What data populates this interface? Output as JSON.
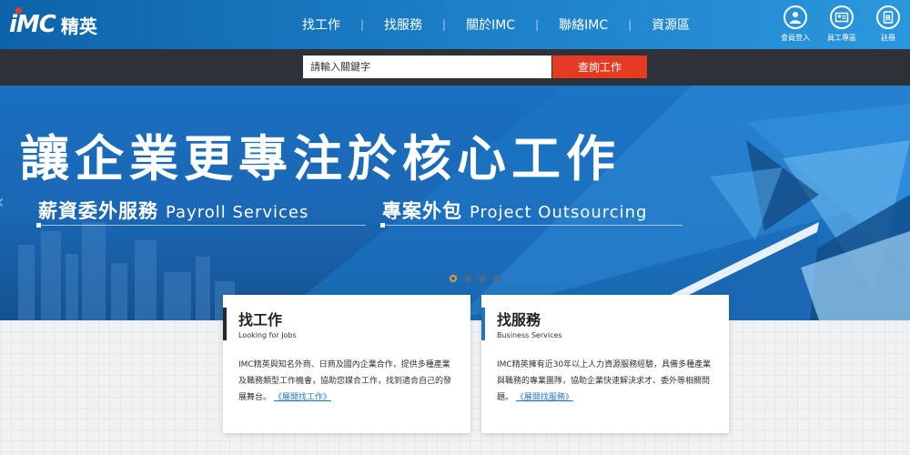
{
  "header": {
    "logo_text": "iMC",
    "logo_cn": "精英",
    "nav": [
      {
        "label": "找工作"
      },
      {
        "label": "找服務"
      },
      {
        "label": "關於IMC"
      },
      {
        "label": "聯絡IMC"
      },
      {
        "label": "資源區"
      }
    ],
    "user_icons": [
      {
        "label": "會員登入",
        "icon": "user-icon"
      },
      {
        "label": "員工專區",
        "icon": "id-card-icon"
      },
      {
        "label": "註冊",
        "icon": "register-icon"
      }
    ]
  },
  "search": {
    "placeholder": "請輸入關鍵字",
    "button_label": "查詢工作"
  },
  "banner": {
    "title": "讓企業更專注於核心工作",
    "services": [
      {
        "cn": "薪資委外服務",
        "en": "Payroll Services"
      },
      {
        "cn": "專案外包",
        "en": "Project Outsourcing"
      }
    ],
    "slide_count": 4,
    "active_slide": 1
  },
  "cards": [
    {
      "title": "找工作",
      "subtitle": "Looking for Jobs",
      "body": "IMC精英與知名外商、日商及國內企業合作，提供多種產業及職務類型工作機會，協助您媒合工作，找到適合自己的發展舞台。",
      "link": "《展開找工作》"
    },
    {
      "title": "找服務",
      "subtitle": "Business Services",
      "body": "IMC精英擁有近30年以上人力資源服務經驗，具備多種產業與職務的專業團隊，協助企業快速解決求才、委外等相關問題。",
      "link": "《展開找服務》"
    }
  ],
  "colors": {
    "header_blue": "#1a7cc4",
    "search_bg": "#2c3238",
    "search_button": "#e63b22",
    "active_dot": "#f29a2e",
    "link_blue": "#1f75c2"
  }
}
